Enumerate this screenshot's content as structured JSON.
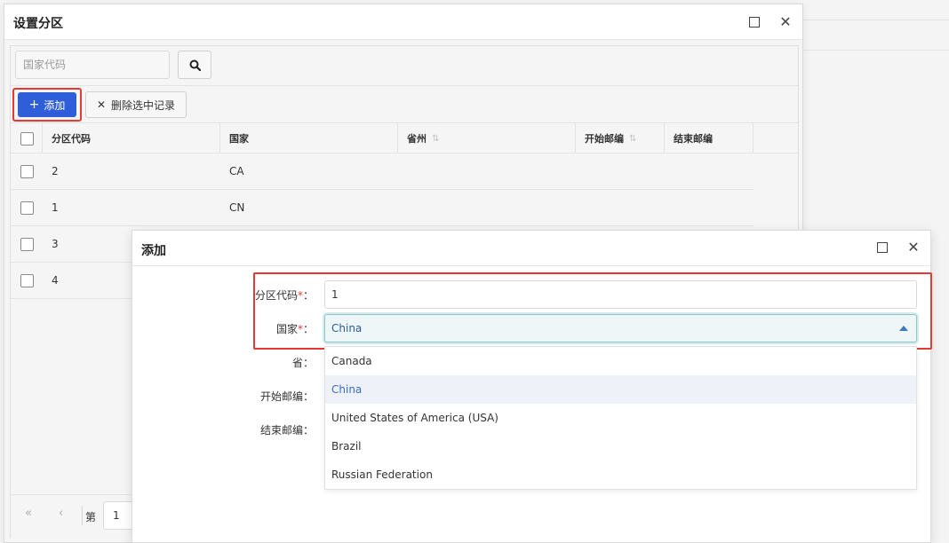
{
  "outer_dialog": {
    "title": "设置分区",
    "search_placeholder": "国家代码",
    "toolbar": {
      "add_label": "添加",
      "delete_label": "删除选中记录"
    },
    "columns": [
      {
        "label": "分区代码",
        "sortable": false
      },
      {
        "label": "国家",
        "sortable": false
      },
      {
        "label": "省州",
        "sortable": true
      },
      {
        "label": "开始邮编",
        "sortable": true
      },
      {
        "label": "结束邮编",
        "sortable": false
      }
    ],
    "rows": [
      {
        "code": "2",
        "country": "CA"
      },
      {
        "code": "1",
        "country": "CN"
      },
      {
        "code": "3",
        "country": ""
      },
      {
        "code": "4",
        "country": ""
      }
    ],
    "pager": {
      "page_label": "第",
      "page_value": "1"
    }
  },
  "inner_dialog": {
    "title": "添加",
    "fields": {
      "zone_code": {
        "label": "分区代码",
        "required": "*",
        "colon": "：",
        "value": "1"
      },
      "country": {
        "label": "国家",
        "required": "*",
        "colon": "：",
        "value": "China"
      },
      "province": {
        "label": "省："
      },
      "start_zip": {
        "label": "开始邮编："
      },
      "end_zip": {
        "label": "结束邮编："
      }
    },
    "country_options": [
      "Canada",
      "China",
      "United States of America (USA)",
      "Brazil",
      "Russian Federation"
    ],
    "selected_option": "China"
  },
  "icons": {
    "maximize": "maximize-icon",
    "close": "close-icon",
    "search": "search-icon",
    "plus": "plus-icon",
    "x": "x-icon",
    "sort": "sort-icon",
    "first_page": "double-chevron-left-icon",
    "prev_page": "chevron-left-icon"
  },
  "colors": {
    "accent": "#2f5fd8",
    "highlight": "#e53935",
    "selected_text": "#3a6cbf"
  }
}
